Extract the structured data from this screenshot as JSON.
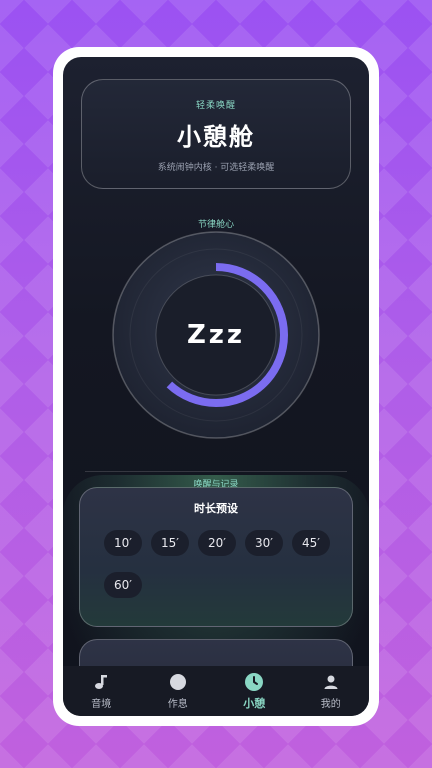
{
  "hero": {
    "kicker": "轻柔唤醒",
    "title": "小憩舱",
    "subtitle": "系统闹钟内核 · 可选轻柔唤醒"
  },
  "dial": {
    "section_label": "节律舱心",
    "center_text": "Zzz",
    "progress_fraction": 0.62,
    "progress_color": "#7b6cf0"
  },
  "wake": {
    "section_label": "唤醒与记录",
    "panel_title": "时长预设",
    "presets": [
      "10′",
      "15′",
      "20′",
      "30′",
      "45′",
      "60′"
    ]
  },
  "tabbar": {
    "items": [
      {
        "label": "音境",
        "icon": "music-note-icon"
      },
      {
        "label": "作息",
        "icon": "circle-icon"
      },
      {
        "label": "小憩",
        "icon": "clock-icon"
      },
      {
        "label": "我的",
        "icon": "person-icon"
      }
    ],
    "active_index": 2,
    "accent": "#8ad7c4"
  }
}
